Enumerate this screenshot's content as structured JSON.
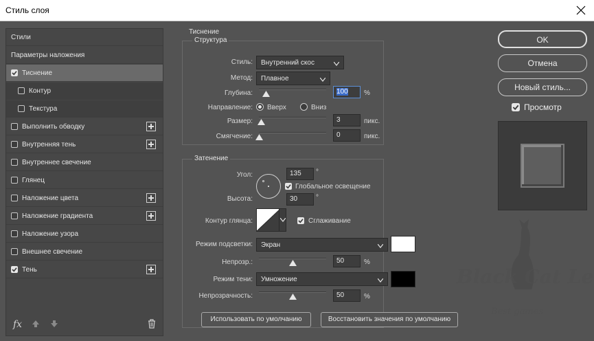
{
  "window": {
    "title": "Стиль слоя"
  },
  "styles_list": {
    "items": [
      {
        "label": "Стили",
        "checkbox": false,
        "checked": false,
        "plus": false,
        "selected": false,
        "sub": false
      },
      {
        "label": "Параметры наложения",
        "checkbox": false,
        "checked": false,
        "plus": false,
        "selected": false,
        "sub": false
      },
      {
        "label": "Тиснение",
        "checkbox": true,
        "checked": true,
        "plus": false,
        "selected": true,
        "sub": false
      },
      {
        "label": "Контур",
        "checkbox": true,
        "checked": false,
        "plus": false,
        "selected": false,
        "sub": true
      },
      {
        "label": "Текстура",
        "checkbox": true,
        "checked": false,
        "plus": false,
        "selected": false,
        "sub": true
      },
      {
        "label": "Выполнить обводку",
        "checkbox": true,
        "checked": false,
        "plus": true,
        "selected": false,
        "sub": false
      },
      {
        "label": "Внутренняя тень",
        "checkbox": true,
        "checked": false,
        "plus": true,
        "selected": false,
        "sub": false
      },
      {
        "label": "Внутреннее свечение",
        "checkbox": true,
        "checked": false,
        "plus": false,
        "selected": false,
        "sub": false
      },
      {
        "label": "Глянец",
        "checkbox": true,
        "checked": false,
        "plus": false,
        "selected": false,
        "sub": false
      },
      {
        "label": "Наложение цвета",
        "checkbox": true,
        "checked": false,
        "plus": true,
        "selected": false,
        "sub": false
      },
      {
        "label": "Наложение градиента",
        "checkbox": true,
        "checked": false,
        "plus": true,
        "selected": false,
        "sub": false
      },
      {
        "label": "Наложение узора",
        "checkbox": true,
        "checked": false,
        "plus": false,
        "selected": false,
        "sub": false
      },
      {
        "label": "Внешнее свечение",
        "checkbox": true,
        "checked": false,
        "plus": false,
        "selected": false,
        "sub": false
      },
      {
        "label": "Тень",
        "checkbox": true,
        "checked": true,
        "plus": true,
        "selected": false,
        "sub": false
      }
    ],
    "footer": {
      "fx_label": "fx"
    }
  },
  "emboss": {
    "heading": "Тиснение",
    "structure": {
      "title": "Структура",
      "style_label": "Стиль:",
      "style_value": "Внутренний скос",
      "method_label": "Метод:",
      "method_value": "Плавное",
      "depth_label": "Глубина:",
      "depth_value": "100",
      "depth_unit": "%",
      "depth_level": 0.1,
      "direction_label": "Направление:",
      "direction_up": "Вверх",
      "direction_down": "Вниз",
      "direction_selected": "up",
      "size_label": "Размер:",
      "size_value": "3",
      "size_unit": "пикс.",
      "size_level": 0.03,
      "soften_label": "Смягчение:",
      "soften_value": "0",
      "soften_unit": "пикс.",
      "soften_level": 0
    },
    "shading": {
      "title": "Затенение",
      "angle_label": "Угол:",
      "angle_value": "135",
      "angle_unit": "°",
      "global_light_label": "Глобальное освещение",
      "global_light_checked": true,
      "altitude_label": "Высота:",
      "altitude_value": "30",
      "altitude_unit": "°",
      "gloss_label": "Контур глянца:",
      "antialias_label": "Сглаживание",
      "antialias_checked": true,
      "highlight_mode_label": "Режим подсветки:",
      "highlight_mode_value": "Экран",
      "highlight_color": "#ffffff",
      "highlight_opacity_label": "Непрозр.:",
      "highlight_opacity_value": "50",
      "highlight_opacity_unit": "%",
      "highlight_opacity_level": 0.5,
      "shadow_mode_label": "Режим тени:",
      "shadow_mode_value": "Умножение",
      "shadow_color": "#000000",
      "shadow_opacity_label": "Непрозрачность:",
      "shadow_opacity_value": "50",
      "shadow_opacity_unit": "%",
      "shadow_opacity_level": 0.5
    },
    "buttons": {
      "make_default": "Использовать по умолчанию",
      "reset_default": "Восстановить значения по умолчанию"
    }
  },
  "actions": {
    "ok": "OK",
    "cancel": "Отмена",
    "new_style": "Новый стиль...",
    "preview_label": "Просмотр",
    "preview_checked": true
  },
  "watermark": {
    "line1": "Black Cat Leo",
    "line2": "Best games"
  }
}
